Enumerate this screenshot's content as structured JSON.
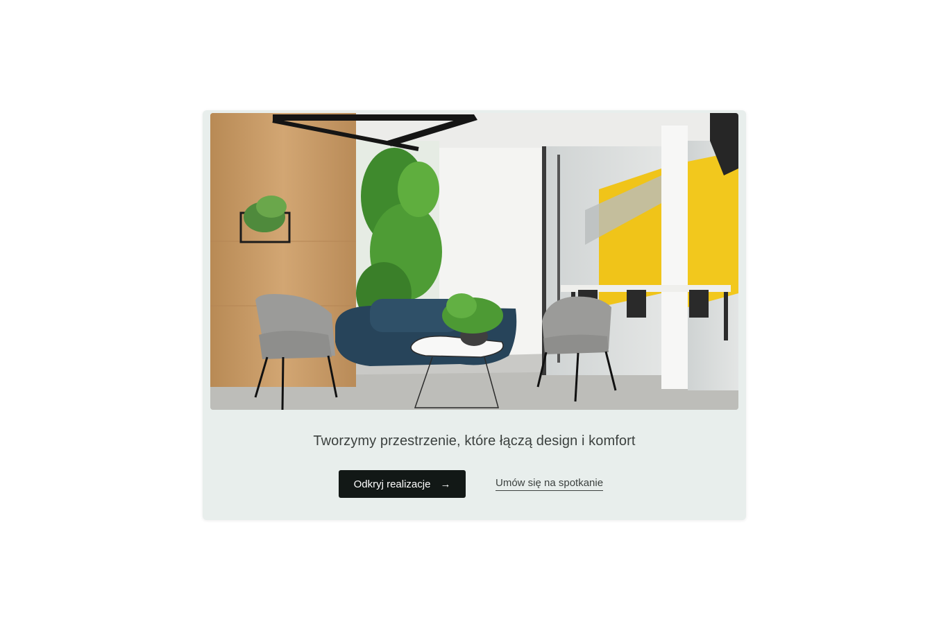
{
  "hero": {
    "image_alt": "Lobby with grey armchairs, blue sofa, plants and glass-walled meeting room"
  },
  "headline": "Tworzymy przestrzenie, które łączą design i komfort",
  "actions": {
    "primary_label": "Odkryj realizacje",
    "primary_icon": "arrow-right-icon",
    "secondary_label": "Umów się na spotkanie"
  },
  "colors": {
    "card_background": "#e8eeec",
    "primary_button": "#121816",
    "text": "#3b403e"
  }
}
